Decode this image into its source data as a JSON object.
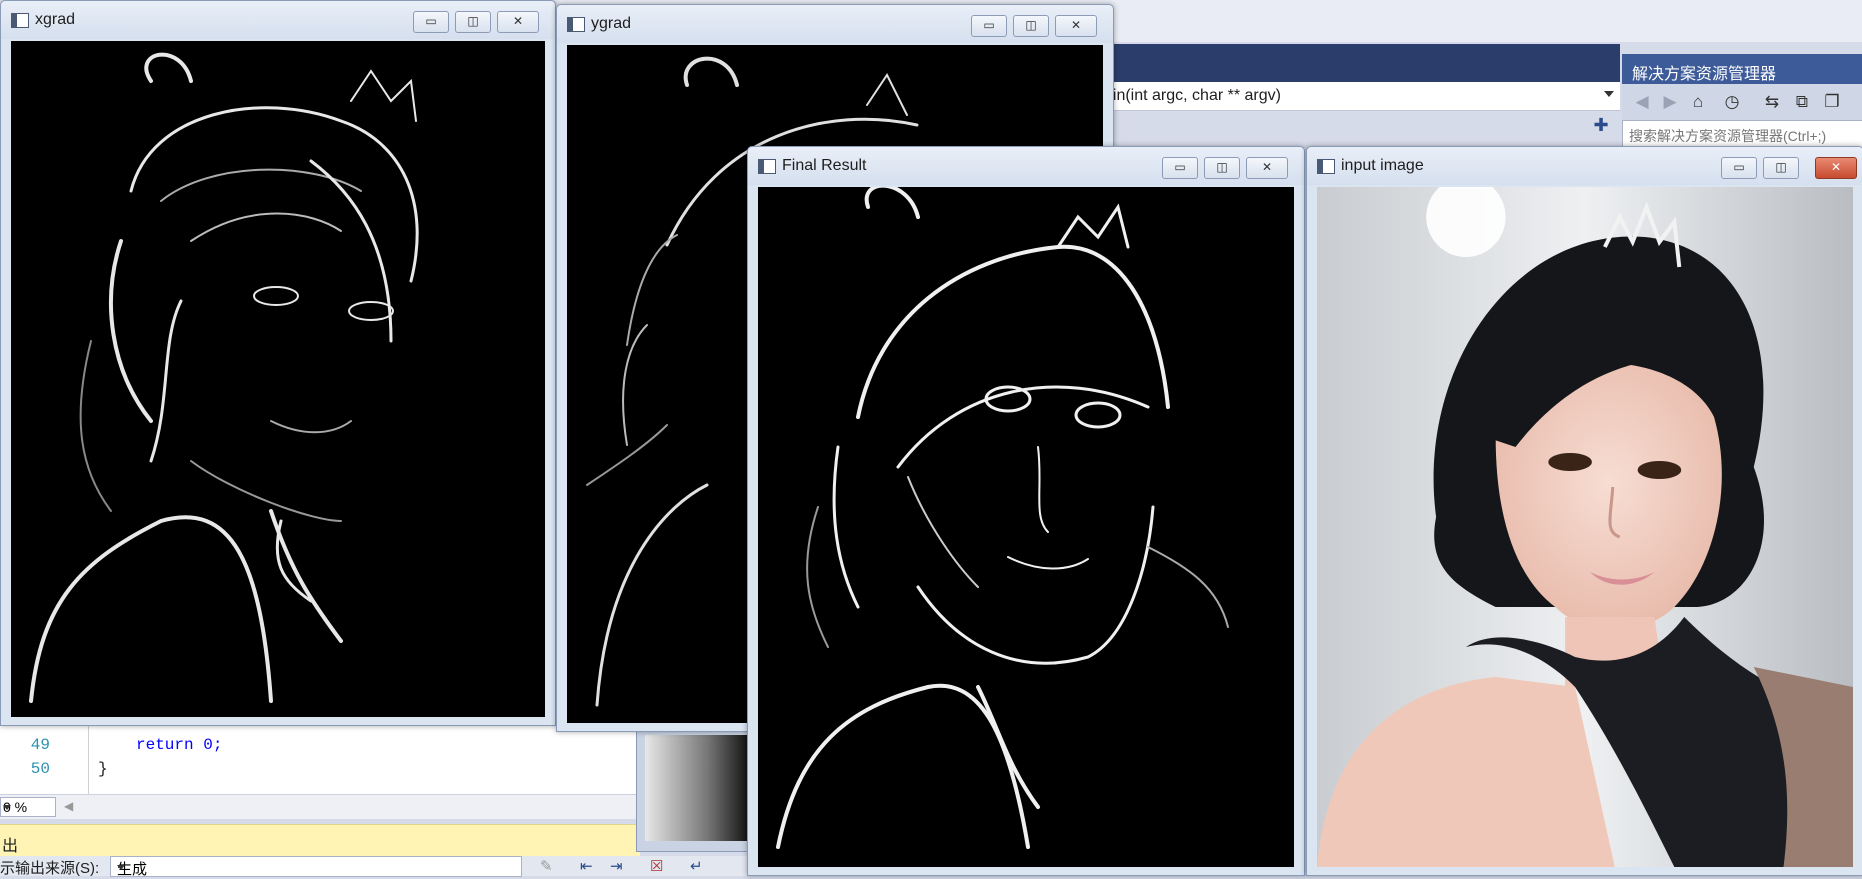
{
  "ide": {
    "function_signature": "ain(int argc, char ** argv)",
    "solution_explorer": {
      "title": "解决方案资源管理器",
      "search_placeholder": "搜索解决方案资源管理器(Ctrl+;)",
      "toolbar_icons": [
        "back-icon",
        "forward-icon",
        "home-icon",
        "history-icon",
        "sync-icon",
        "collapse-icon",
        "copy-icon"
      ]
    },
    "code": {
      "lines": [
        {
          "number": "49",
          "text": "return 0;"
        },
        {
          "number": "50",
          "text": "}"
        }
      ]
    },
    "zoom": {
      "value": "0 %"
    },
    "output": {
      "title": "出",
      "source_label": "示输出来源(S):",
      "source_value": "生成"
    }
  },
  "windows": {
    "xgrad": {
      "title": "xgrad",
      "buttons": [
        "▭",
        "◫",
        "✕"
      ]
    },
    "ygrad": {
      "title": "ygrad",
      "buttons": [
        "▭",
        "◫",
        "✕"
      ]
    },
    "final": {
      "title": "Final Result",
      "buttons": [
        "▭",
        "◫",
        "✕"
      ]
    },
    "input": {
      "title": "input image",
      "buttons": [
        "▭",
        "◫",
        "✕"
      ]
    }
  },
  "colors": {
    "ide_dark_bar": "#2b3e6b",
    "solution_header": "#3d5a99",
    "output_header": "#fff4b3",
    "close_button_active": "#c74b2f"
  }
}
